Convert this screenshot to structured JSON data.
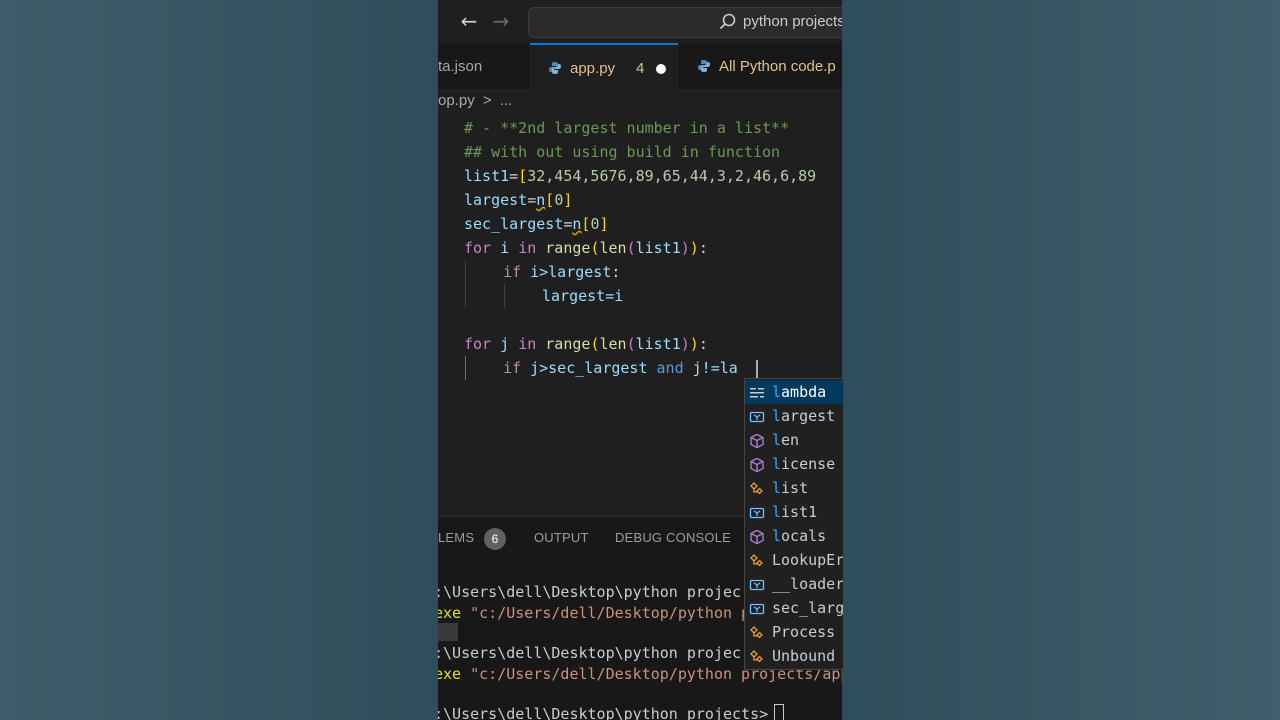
{
  "command_center": {
    "text": "python projects"
  },
  "tabs": [
    {
      "label": "ta.json"
    },
    {
      "label": "app.py",
      "problems": "4"
    },
    {
      "label": "All Python code.p"
    }
  ],
  "breadcrumb": {
    "file": "op.py",
    "sep": ">",
    "more": "..."
  },
  "code": {
    "l1": "# - **2nd largest number in a list**",
    "l2": "## with out using build in function",
    "l3_var": "list1",
    "l3_vals": "32,454,5676,89,65,44,3,2,46,6,89",
    "l4_var": "largest",
    "l4_n": "n",
    "l4_idx": "0",
    "l5_var": "sec_largest",
    "l5_n": "n",
    "l5_idx": "0",
    "l6_kw1": "for",
    "l6_i": "i",
    "l6_kw2": "in",
    "l6_range": "range",
    "l6_len": "len",
    "l6_list": "list1",
    "l7_kw": "if",
    "l7_cond": "i>largest",
    "l8_assign": "largest=i",
    "l10_kw1": "for",
    "l10_j": "j",
    "l10_kw2": "in",
    "l10_range": "range",
    "l10_len": "len",
    "l10_list": "list1",
    "l11_kw": "if",
    "l11_cond": "j>sec_largest",
    "l11_and": "and",
    "l11_tail": "j!=la"
  },
  "suggestions": [
    {
      "label_match": "l",
      "label_rest": "ambda",
      "icon": "keyword-icon"
    },
    {
      "label_match": "l",
      "label_rest": "argest",
      "icon": "variable-icon"
    },
    {
      "label_match": "l",
      "label_rest": "en",
      "icon": "function-icon"
    },
    {
      "label_match": "l",
      "label_rest": "icense",
      "icon": "function-icon"
    },
    {
      "label_match": "l",
      "label_rest": "ist",
      "icon": "class-icon"
    },
    {
      "label_match": "l",
      "label_rest": "ist1",
      "icon": "variable-icon"
    },
    {
      "label_match": "l",
      "label_rest": "ocals",
      "icon": "function-icon"
    },
    {
      "label_match": "",
      "label_rest": "LookupEr",
      "icon": "class-icon"
    },
    {
      "label_match": "",
      "label_rest": "__loader",
      "icon": "variable-icon"
    },
    {
      "label_match": "",
      "label_rest": "sec_larg",
      "icon": "variable-icon"
    },
    {
      "label_match": "",
      "label_rest": "Process",
      "icon": "class-icon"
    },
    {
      "label_match": "",
      "label_rest": "Unbound",
      "icon": "class-icon"
    }
  ],
  "panel": {
    "tabs": [
      "LEMS",
      "OUTPUT",
      "DEBUG CONSOLE"
    ],
    "problems_count": "6",
    "terminal": {
      "line1": ":\\Users\\dell\\Desktop\\python projec",
      "line2_exe": "exe",
      "line2_str": "\"c:/Users/dell/Desktop/python p",
      "line3": ":\\Users\\dell\\Desktop\\python projec",
      "line4_exe": "exe",
      "line4_str": "\"c:/Users/dell/Desktop/python projects/app",
      "line5": ":\\Users\\dell\\Desktop\\python projects>"
    }
  },
  "colors": {
    "accent": "#0078d4",
    "editor_bg": "#1f1f1f",
    "selection": "#04395e"
  }
}
